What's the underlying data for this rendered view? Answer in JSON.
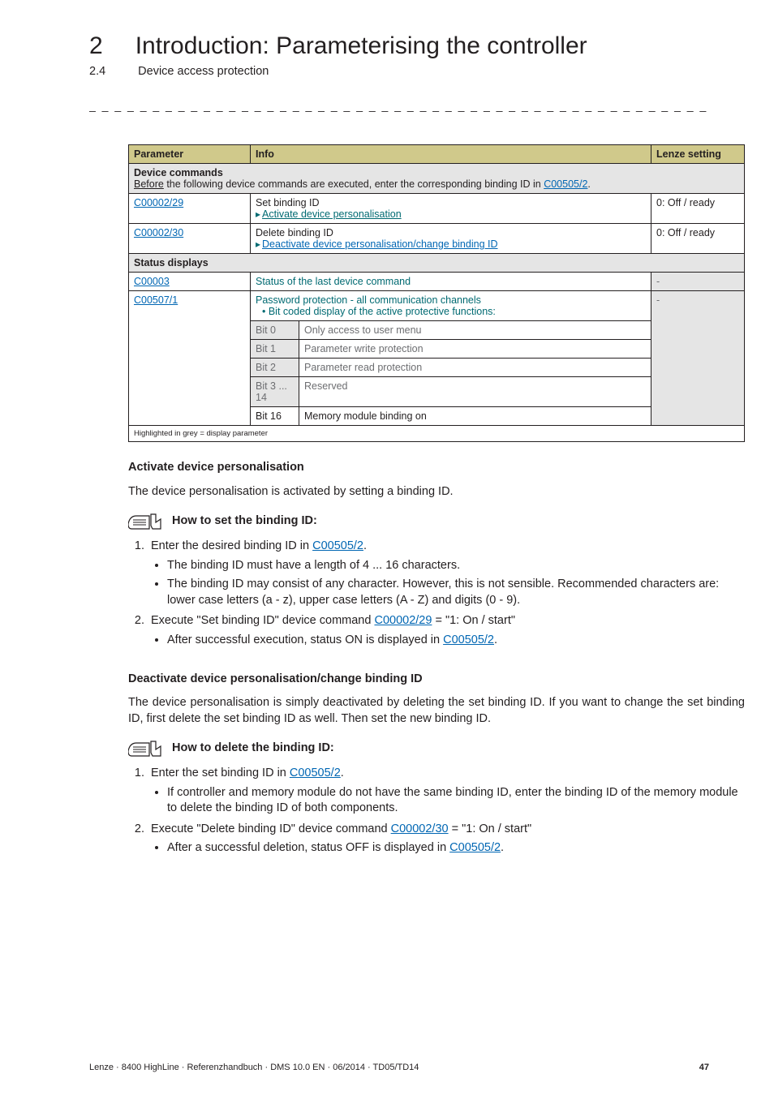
{
  "header": {
    "chapter_num": "2",
    "chapter_title": "Introduction: Parameterising the controller",
    "section_num": "2.4",
    "section_title": "Device access protection"
  },
  "table": {
    "head": {
      "param": "Parameter",
      "info": "Info",
      "setting": "Lenze setting"
    },
    "section1_label": "Device commands",
    "section1_note_pre": "Before",
    "section1_note_rest": " the following device commands are executed, enter the corresponding binding ID in ",
    "section1_note_link": "C00505/2",
    "row1": {
      "param": "C00002/29",
      "info_line1": "Set binding ID",
      "info_link": "Activate device personalisation",
      "setting": "0: Off / ready"
    },
    "row2": {
      "param": "C00002/30",
      "info_line1": "Delete binding ID",
      "info_link": "Deactivate device personalisation/change binding ID",
      "setting": "0: Off / ready"
    },
    "section2_label": "Status displays",
    "row3": {
      "param": "C00003",
      "info": "Status of the last device command",
      "setting": "-"
    },
    "row4": {
      "param": "C00507/1",
      "info_line1": "Password protection - all communication channels",
      "info_line2": "• Bit coded display of the active protective functions:",
      "setting": "-"
    },
    "bits": {
      "b0l": "Bit 0",
      "b0v": "Only access to user menu",
      "b1l": "Bit 1",
      "b1v": "Parameter write protection",
      "b2l": "Bit 2",
      "b2v": "Parameter read protection",
      "b3l": "Bit 3 ... 14",
      "b3v": "Reserved",
      "b16l": "Bit 16",
      "b16v": "Memory module binding on"
    },
    "footnote": "Highlighted in grey = display parameter"
  },
  "sectionA": {
    "heading": "Activate device personalisation",
    "intro": "The device personalisation is activated by setting a binding ID.",
    "howto": "How to set the binding ID:",
    "step1_pre": "Enter the desired binding ID in ",
    "step1_link": "C00505/2",
    "step1_post": ".",
    "b1": "The binding ID must have a length of 4 ... 16 characters.",
    "b2": "The binding ID may consist of any character. However, this is not sensible. Recommended characters are: lower case letters (a - z), upper case letters (A - Z) and digits (0 - 9).",
    "step2_pre": "Execute \"Set binding ID\" device command ",
    "step2_link": "C00002/29",
    "step2_post": "  = \"1: On / start\"",
    "b3_pre": "After successful execution, status ON is displayed in ",
    "b3_link": "C00505/2",
    "b3_post": "."
  },
  "sectionB": {
    "heading": "Deactivate device personalisation/change binding ID",
    "intro": "The device personalisation is simply deactivated by deleting the set binding ID. If you want to change the set binding ID, first delete the set binding ID as well. Then set the new binding ID.",
    "howto": "How to delete the binding ID:",
    "step1_pre": "Enter the set binding ID in ",
    "step1_link": "C00505/2",
    "step1_post": ".",
    "b1": "If controller and memory module do not have the same binding ID, enter the binding ID of the memory module to delete the binding ID of both components.",
    "step2_pre": "Execute \"Delete binding ID\" device command ",
    "step2_link": "C00002/30",
    "step2_post": "  = \"1: On / start\"",
    "b2_pre": "After a successful deletion, status OFF is displayed in ",
    "b2_link": "C00505/2",
    "b2_post": "."
  },
  "footer": {
    "left": "Lenze · 8400 HighLine · Referenzhandbuch · DMS 10.0 EN · 06/2014 · TD05/TD14",
    "right": "47"
  }
}
